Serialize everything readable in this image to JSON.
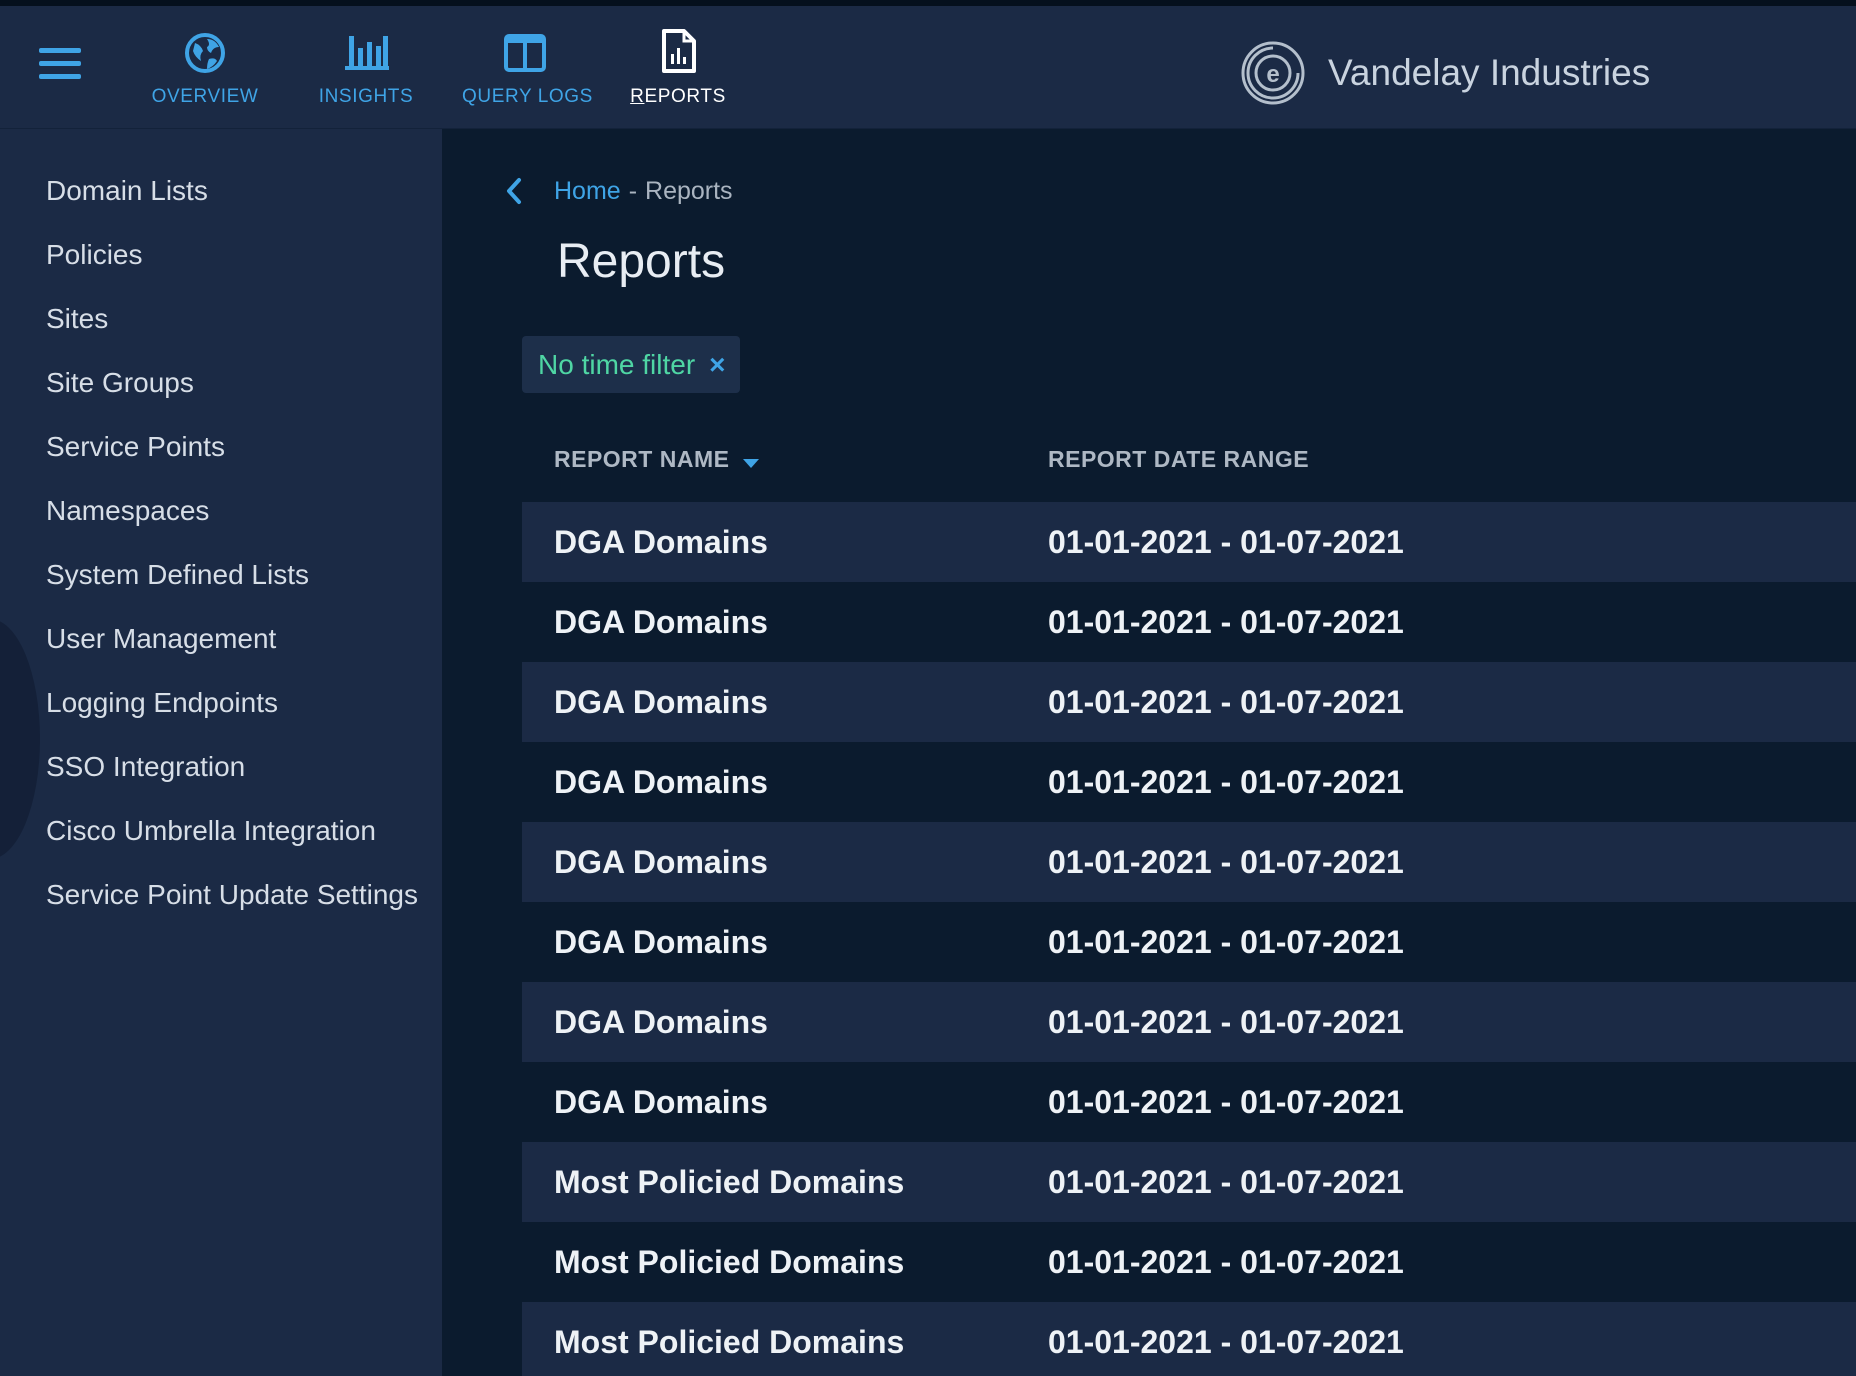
{
  "topnav": {
    "items": [
      {
        "label": "OVERVIEW",
        "icon": "globe-icon"
      },
      {
        "label": "INSIGHTS",
        "icon": "bar-chart-icon"
      },
      {
        "label": "QUERY LOGS",
        "icon": "columns-icon"
      },
      {
        "label": "REPORTS",
        "icon": "report-document-icon",
        "active": true
      }
    ],
    "brand": "Vandelay Industries",
    "accent_color": "#3fa4e6"
  },
  "sidebar": {
    "items": [
      "Domain Lists",
      "Policies",
      "Sites",
      "Site Groups",
      "Service Points",
      "Namespaces",
      "System Defined Lists",
      "User Management",
      "Logging Endpoints",
      "SSO Integration",
      "Cisco Umbrella Integration",
      "Service Point Update Settings"
    ]
  },
  "breadcrumb": {
    "home": "Home",
    "separator": "-",
    "current": "Reports"
  },
  "page_title": "Reports",
  "filter": {
    "label": "No time filter",
    "close": "×",
    "color": "#4fd6a4"
  },
  "table": {
    "columns": [
      "REPORT NAME",
      "REPORT DATE RANGE"
    ],
    "rows": [
      {
        "name": "DGA Domains",
        "range": "01-01-2021 - 01-07-2021"
      },
      {
        "name": "DGA Domains",
        "range": "01-01-2021 - 01-07-2021"
      },
      {
        "name": "DGA Domains",
        "range": "01-01-2021 - 01-07-2021"
      },
      {
        "name": "DGA Domains",
        "range": "01-01-2021 - 01-07-2021"
      },
      {
        "name": "DGA Domains",
        "range": "01-01-2021 - 01-07-2021"
      },
      {
        "name": "DGA Domains",
        "range": "01-01-2021 - 01-07-2021"
      },
      {
        "name": "DGA Domains",
        "range": "01-01-2021 - 01-07-2021"
      },
      {
        "name": "DGA Domains",
        "range": "01-01-2021 - 01-07-2021"
      },
      {
        "name": "Most Policied Domains",
        "range": "01-01-2021 - 01-07-2021"
      },
      {
        "name": "Most Policied Domains",
        "range": "01-01-2021 - 01-07-2021"
      },
      {
        "name": "Most Policied Domains",
        "range": "01-01-2021 - 01-07-2021"
      }
    ]
  }
}
